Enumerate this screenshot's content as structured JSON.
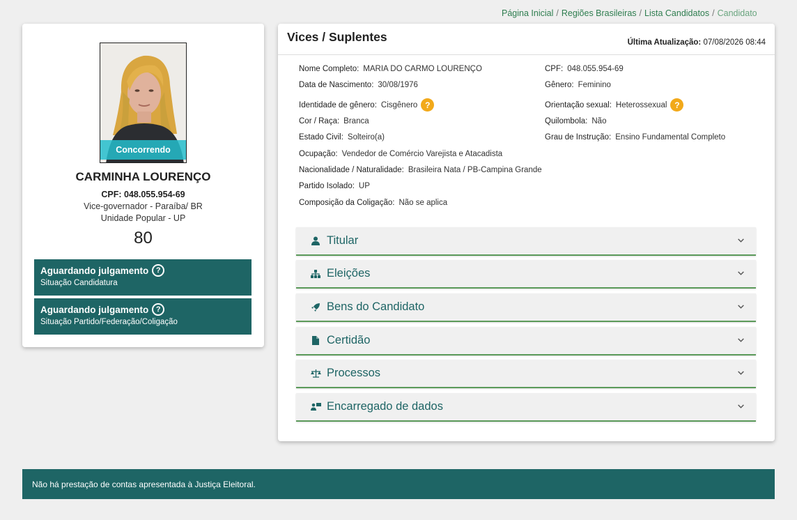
{
  "breadcrumb": [
    {
      "label": "Página Inicial"
    },
    {
      "label": "Regiões Brasileiras"
    },
    {
      "label": "Lista Candidatos"
    },
    {
      "label": "Candidato"
    }
  ],
  "profile": {
    "status_ribbon": "Concorrendo",
    "name": "CARMINHA LOURENÇO",
    "cpf": "CPF: 048.055.954-69",
    "office": "Vice-governador - Paraíba/ BR",
    "party": "Unidade Popular - UP",
    "number": "80",
    "judgments": [
      {
        "title": "Aguardando julgamento",
        "subtitle": "Situação Candidatura"
      },
      {
        "title": "Aguardando julgamento",
        "subtitle": "Situação Partido/Federação/Coligação"
      }
    ]
  },
  "main": {
    "title": "Vices / Suplentes",
    "last_update_label": "Última Atualização:",
    "last_update_value": "07/08/2026 08:44",
    "fields": {
      "nome_completo": {
        "label": "Nome Completo:",
        "value": "MARIA DO CARMO LOURENÇO"
      },
      "cpf": {
        "label": "CPF:",
        "value": "048.055.954-69"
      },
      "data_nascimento": {
        "label": "Data de Nascimento:",
        "value": "30/08/1976"
      },
      "genero": {
        "label": "Gênero:",
        "value": "Feminino"
      },
      "identidade_genero": {
        "label": "Identidade de gênero:",
        "value": "Cisgênero"
      },
      "orientacao_sexual": {
        "label": "Orientação sexual:",
        "value": "Heterossexual"
      },
      "cor_raca": {
        "label": "Cor / Raça:",
        "value": "Branca"
      },
      "quilombola": {
        "label": "Quilombola:",
        "value": "Não"
      },
      "estado_civil": {
        "label": "Estado Civil:",
        "value": "Solteiro(a)"
      },
      "grau_instrucao": {
        "label": "Grau de Instrução:",
        "value": "Ensino Fundamental Completo"
      },
      "ocupacao": {
        "label": "Ocupação:",
        "value": "Vendedor de Comércio Varejista e Atacadista"
      },
      "nacionalidade": {
        "label": "Nacionalidade / Naturalidade:",
        "value": "Brasileira Nata / PB-Campina Grande"
      },
      "partido_isolado": {
        "label": "Partido Isolado:",
        "value": "UP"
      },
      "composicao_coligacao": {
        "label": "Composição da Coligação:",
        "value": "Não se aplica"
      }
    },
    "help_badge": "?",
    "accordion": [
      {
        "label": "Titular",
        "icon": "user-icon"
      },
      {
        "label": "Eleições",
        "icon": "sitemap-icon"
      },
      {
        "label": "Bens do Candidato",
        "icon": "rocket-icon"
      },
      {
        "label": "Certidão",
        "icon": "file-icon"
      },
      {
        "label": "Processos",
        "icon": "scale-icon"
      },
      {
        "label": "Encarregado de dados",
        "icon": "data-officer-icon"
      }
    ]
  },
  "footer": {
    "message": "Não há prestação de contas apresentada à Justiça Eleitoral."
  },
  "colors": {
    "primary_teal": "#1e6565",
    "breadcrumb_green": "#2e7d4f",
    "ribbon_cyan": "#24becc",
    "help_orange": "#f2a91a",
    "accordion_border": "#5b9a5a"
  }
}
